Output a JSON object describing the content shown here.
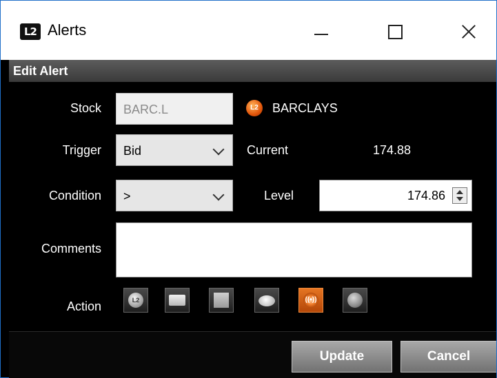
{
  "window": {
    "title": "Alerts",
    "app_icon_text": "L2"
  },
  "section": {
    "title": "Edit Alert"
  },
  "form": {
    "stock_label": "Stock",
    "stock_value": "BARC.L",
    "stock_badge_text": "L2",
    "stock_name": "BARCLAYS",
    "trigger_label": "Trigger",
    "trigger_value": "Bid",
    "current_label": "Current",
    "current_value": "174.88",
    "condition_label": "Condition",
    "condition_value": ">",
    "level_label": "Level",
    "level_value": "174.86",
    "comments_label": "Comments",
    "comments_value": "",
    "action_label": "Action"
  },
  "actions": [
    {
      "icon": "l2-icon",
      "text": "L2"
    },
    {
      "icon": "message-icon",
      "text": ""
    },
    {
      "icon": "chart-icon",
      "text": ""
    },
    {
      "icon": "speech-bubble-icon",
      "text": ""
    },
    {
      "icon": "broadcast-icon",
      "text": "((•))",
      "selected": true
    },
    {
      "icon": "speaker-icon",
      "text": ""
    }
  ],
  "buttons": {
    "update": "Update",
    "cancel": "Cancel"
  },
  "colors": {
    "accent": "#e2560b",
    "window_border": "#1f6fc9"
  }
}
